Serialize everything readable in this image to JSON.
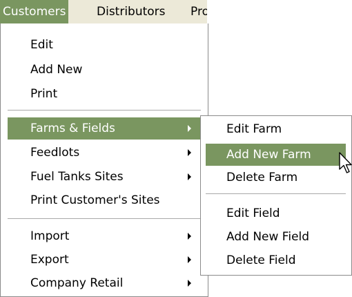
{
  "menubar": {
    "tabs": [
      {
        "label": "Customers"
      },
      {
        "label": "Distributors"
      },
      {
        "label": "Pro"
      }
    ]
  },
  "main_menu": {
    "items": [
      {
        "label": "Edit"
      },
      {
        "label": "Add New"
      },
      {
        "label": "Print"
      },
      {
        "label": "Farms & Fields"
      },
      {
        "label": "Feedlots"
      },
      {
        "label": "Fuel Tanks Sites"
      },
      {
        "label": "Print Customer's Sites"
      },
      {
        "label": "Import"
      },
      {
        "label": "Export"
      },
      {
        "label": "Company Retail"
      }
    ]
  },
  "sub_menu": {
    "items": [
      {
        "label": "Edit Farm"
      },
      {
        "label": "Add New Farm"
      },
      {
        "label": "Delete Farm"
      },
      {
        "label": "Edit Field"
      },
      {
        "label": "Add New Field"
      },
      {
        "label": "Delete Field"
      }
    ]
  },
  "colors": {
    "highlight": "#7a9660",
    "menubar_bg": "#ece9d8",
    "menu_bg": "#ffffff"
  },
  "icons": {
    "submenu_arrow": "triangle-right",
    "cursor": "arrow-pointer"
  }
}
